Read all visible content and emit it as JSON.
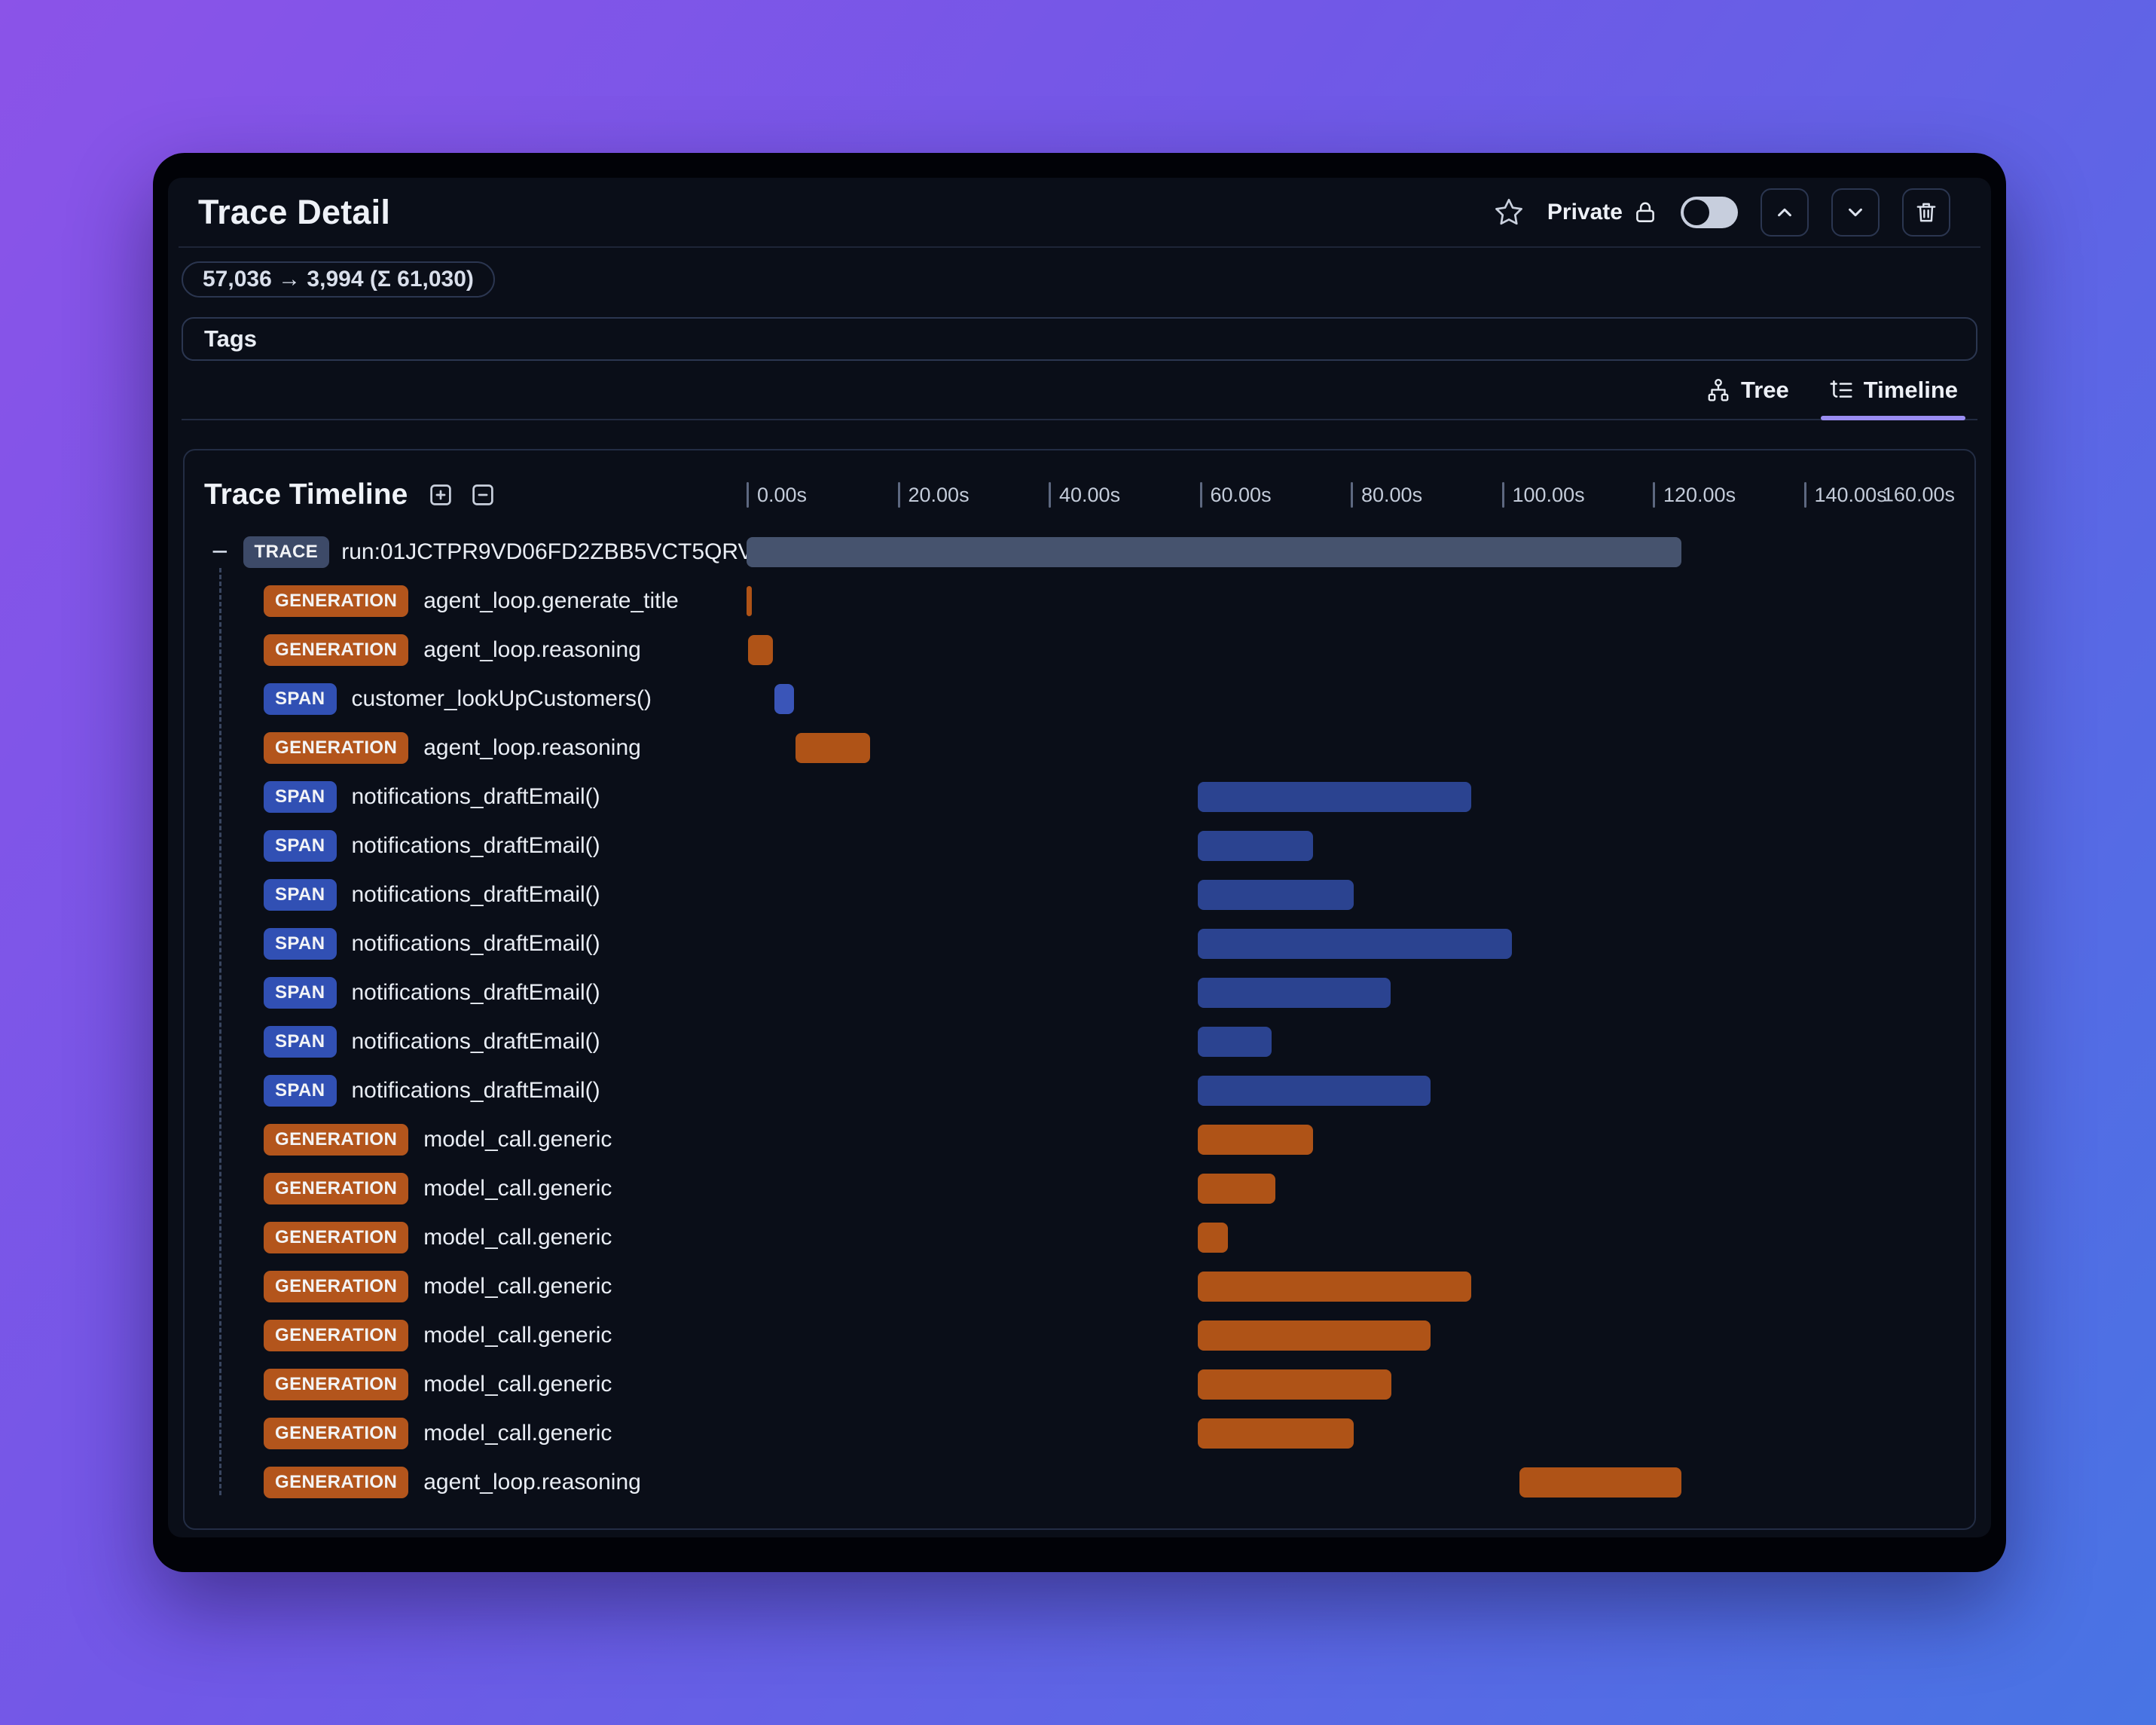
{
  "window": {
    "title": "Trace Detail"
  },
  "header": {
    "private_label": "Private",
    "icons": [
      "star-icon",
      "lock-icon",
      "privacy-toggle",
      "chevron-up-icon",
      "chevron-down-icon",
      "trash-icon"
    ],
    "privacy_toggle_on": false
  },
  "token_badge": {
    "text": "57,036 → 3,994 (Σ 61,030)"
  },
  "tags": {
    "label": "Tags"
  },
  "view_tabs": [
    {
      "label": "Tree",
      "icon": "tree-icon",
      "active": false
    },
    {
      "label": "Timeline",
      "icon": "list-tree-icon",
      "active": true
    }
  ],
  "timeline": {
    "title": "Trace Timeline",
    "collapse_glyph": "−",
    "toolbar_icons": [
      "expand-all-icon",
      "collapse-all-icon"
    ],
    "axis": {
      "max": 160,
      "unit": "s",
      "ticks": [
        {
          "label": "0.00s",
          "value": 0
        },
        {
          "label": "20.00s",
          "value": 20
        },
        {
          "label": "40.00s",
          "value": 40
        },
        {
          "label": "60.00s",
          "value": 60
        },
        {
          "label": "80.00s",
          "value": 80
        },
        {
          "label": "100.00s",
          "value": 100
        },
        {
          "label": "120.00s",
          "value": 120
        },
        {
          "label": "140.00s",
          "value": 140
        }
      ],
      "end_label": "160.00s"
    },
    "rows": [
      {
        "type": "TRACE",
        "name": "run:01JCTPR9VD06FD2ZBB5VCT5QRV",
        "start": 0,
        "end": 123.8,
        "color": "slate",
        "collapser": true
      },
      {
        "type": "GENERATION",
        "name": "agent_loop.generate_title",
        "start": 0,
        "end": 0.7,
        "color": "orange"
      },
      {
        "type": "GENERATION",
        "name": "agent_loop.reasoning",
        "start": 0.2,
        "end": 3.5,
        "color": "orange"
      },
      {
        "type": "SPAN",
        "name": "customer_lookUpCustomers()",
        "start": 3.7,
        "end": 6.3,
        "color": "blue_bright"
      },
      {
        "type": "GENERATION",
        "name": "agent_loop.reasoning",
        "start": 6.5,
        "end": 16.4,
        "color": "orange"
      },
      {
        "type": "SPAN",
        "name": "notifications_draftEmail()",
        "start": 59.8,
        "end": 96.0,
        "color": "blue"
      },
      {
        "type": "SPAN",
        "name": "notifications_draftEmail()",
        "start": 59.8,
        "end": 75.0,
        "color": "blue"
      },
      {
        "type": "SPAN",
        "name": "notifications_draftEmail()",
        "start": 59.8,
        "end": 80.4,
        "color": "blue"
      },
      {
        "type": "SPAN",
        "name": "notifications_draftEmail()",
        "start": 59.8,
        "end": 101.3,
        "color": "blue"
      },
      {
        "type": "SPAN",
        "name": "notifications_draftEmail()",
        "start": 59.8,
        "end": 85.3,
        "color": "blue"
      },
      {
        "type": "SPAN",
        "name": "notifications_draftEmail()",
        "start": 59.8,
        "end": 69.5,
        "color": "blue"
      },
      {
        "type": "SPAN",
        "name": "notifications_draftEmail()",
        "start": 59.8,
        "end": 90.6,
        "color": "blue"
      },
      {
        "type": "GENERATION",
        "name": "model_call.generic",
        "start": 59.8,
        "end": 75.0,
        "color": "orange"
      },
      {
        "type": "GENERATION",
        "name": "model_call.generic",
        "start": 59.8,
        "end": 70.0,
        "color": "orange"
      },
      {
        "type": "GENERATION",
        "name": "model_call.generic",
        "start": 59.8,
        "end": 63.7,
        "color": "orange"
      },
      {
        "type": "GENERATION",
        "name": "model_call.generic",
        "start": 59.8,
        "end": 96.0,
        "color": "orange"
      },
      {
        "type": "GENERATION",
        "name": "model_call.generic",
        "start": 59.8,
        "end": 90.6,
        "color": "orange"
      },
      {
        "type": "GENERATION",
        "name": "model_call.generic",
        "start": 59.8,
        "end": 85.4,
        "color": "orange"
      },
      {
        "type": "GENERATION",
        "name": "model_call.generic",
        "start": 59.8,
        "end": 80.4,
        "color": "orange"
      },
      {
        "type": "GENERATION",
        "name": "agent_loop.reasoning",
        "start": 102.3,
        "end": 123.8,
        "color": "orange"
      }
    ]
  },
  "colors": {
    "accent": "#9a8df2",
    "badge_trace": "#3d4a68",
    "badge_generation": "#b3551c",
    "badge_span": "#3150b4",
    "bar_slate": "#46536e",
    "bar_orange": "#af5317",
    "bar_blue": "#2b4390",
    "bar_blue_bright": "#3a55b8",
    "background_gradient_start": "#8b53e8",
    "background_gradient_end": "#4874e4"
  }
}
